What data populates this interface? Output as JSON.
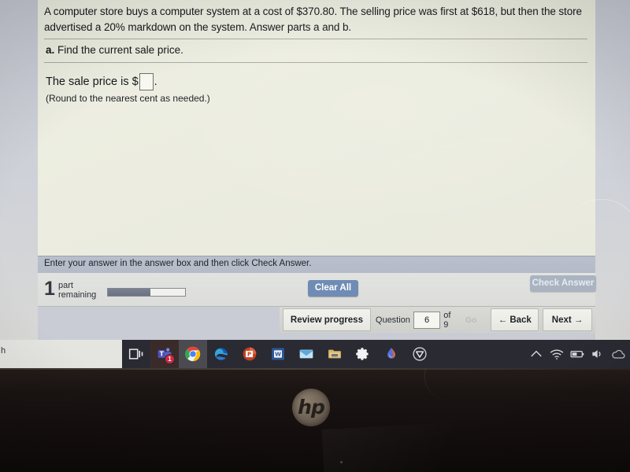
{
  "exercise": {
    "question_stem": "A computer store buys a computer system at a cost of $370.80. The selling price was first at $618, but then the store advertised a 20% markdown on the system. Answer parts a and b.",
    "part_prefix": "a.",
    "part_text": "Find the current sale price.",
    "answer_prompt_before": "The sale price is $",
    "answer_prompt_after": ".",
    "answer_value": "",
    "rounding_note": "(Round to the nearest cent as needed.)"
  },
  "instruction": {
    "text": "Enter your answer in the answer box and then click Check Answer."
  },
  "controls": {
    "parts_remaining_count": "1",
    "parts_remaining_label_line1": "part",
    "parts_remaining_label_line2": "remaining",
    "progress_percent": 55,
    "clear_all_label": "Clear All",
    "check_answer_label": "Check Answer"
  },
  "navigation": {
    "review_progress_label": "Review progress",
    "question_label": "Question",
    "question_number": "6",
    "of_label": "of 9",
    "go_label": "Go",
    "back_label": "← Back",
    "next_label": "Next →"
  },
  "taskbar": {
    "items": [
      {
        "name": "task-view-icon",
        "label": "Task View"
      },
      {
        "name": "microsoft-teams-icon",
        "label": "Microsoft Teams",
        "badge": "1"
      },
      {
        "name": "google-chrome-icon",
        "label": "Google Chrome"
      },
      {
        "name": "microsoft-edge-icon",
        "label": "Microsoft Edge"
      },
      {
        "name": "powerpoint-icon",
        "label": "PowerPoint"
      },
      {
        "name": "word-icon",
        "label": "Word"
      },
      {
        "name": "mail-icon",
        "label": "Mail"
      },
      {
        "name": "file-explorer-icon",
        "label": "File Explorer"
      },
      {
        "name": "settings-gear-icon",
        "label": "Settings"
      },
      {
        "name": "droplet-app-icon",
        "label": "Droplet App"
      },
      {
        "name": "shield-app-icon",
        "label": "Security Shield"
      }
    ],
    "tray": [
      {
        "name": "show-hidden-icons-chevron-icon",
        "glyph": "∧"
      },
      {
        "name": "wifi-icon",
        "glyph": "◔"
      },
      {
        "name": "battery-icon",
        "glyph": "▭"
      },
      {
        "name": "volume-icon",
        "glyph": "◁"
      },
      {
        "name": "onedrive-icon",
        "glyph": "☁"
      }
    ]
  },
  "desktop": {
    "cut_off_text": "h"
  },
  "device": {
    "brand_logo_text": "hp"
  },
  "colors": {
    "paper": "#eef0e3",
    "instruction_bar": "#b7bdc9",
    "primary_button": "#6f8cb4",
    "disabled_button": "#aab4c0",
    "taskbar": "#2a2a33",
    "badge": "#d0273e"
  }
}
